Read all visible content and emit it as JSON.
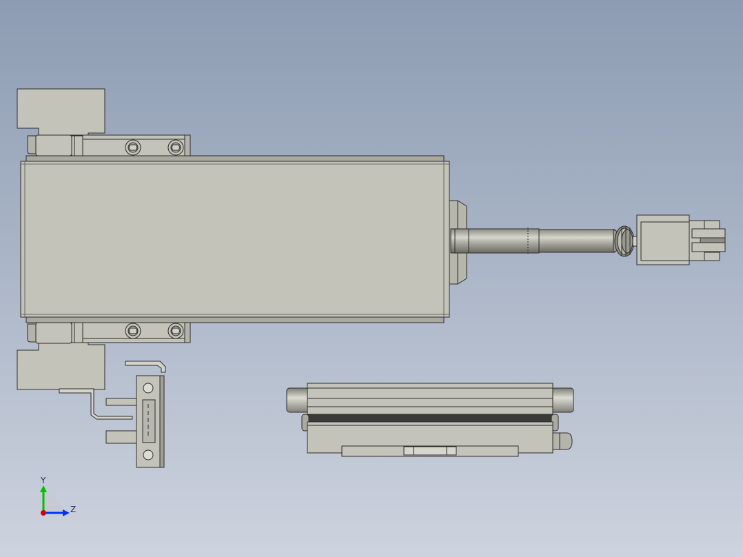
{
  "colors": {
    "part_fill": "#c3c3b9",
    "part_stroke": "#2c2c2c",
    "shadow": "#9a9a90",
    "axis_x": "#d40000",
    "axis_y": "#00c000",
    "axis_z": "#0030ff",
    "axis_label": "#1a2a6a"
  },
  "triad": {
    "y_label": "Y",
    "z_label": "Z"
  }
}
